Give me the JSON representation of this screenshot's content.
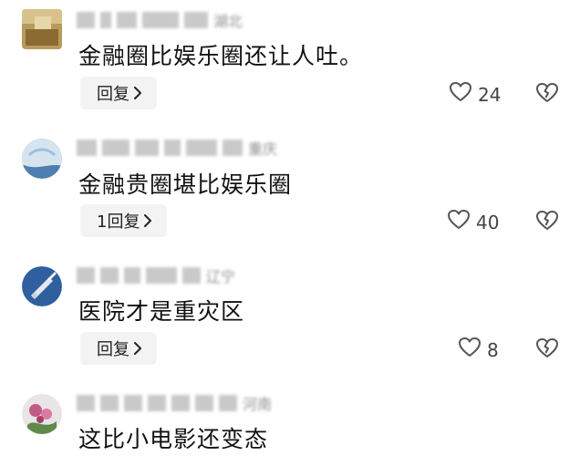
{
  "comments": [
    {
      "meta_tail": "湖北",
      "text": "金融圈比娱乐圈还让人吐。",
      "reply_label": "回复",
      "likes": "24"
    },
    {
      "meta_tail": "重庆",
      "text": "金融贵圈堪比娱乐圈",
      "reply_label": "1回复",
      "likes": "40"
    },
    {
      "meta_tail": "辽宁",
      "text": "医院才是重灾区",
      "reply_label": "回复",
      "likes": "8"
    },
    {
      "meta_tail": "河南",
      "text": "这比小电影还变态"
    }
  ],
  "icons": {
    "reply_chevron": "chevron-right-icon",
    "like": "heart-outline-icon",
    "dislike": "broken-heart-icon"
  },
  "colors": {
    "text": "#111111",
    "meta": "#9a9a9a",
    "reply_bg": "#f3f3f3",
    "icon": "#555555"
  }
}
